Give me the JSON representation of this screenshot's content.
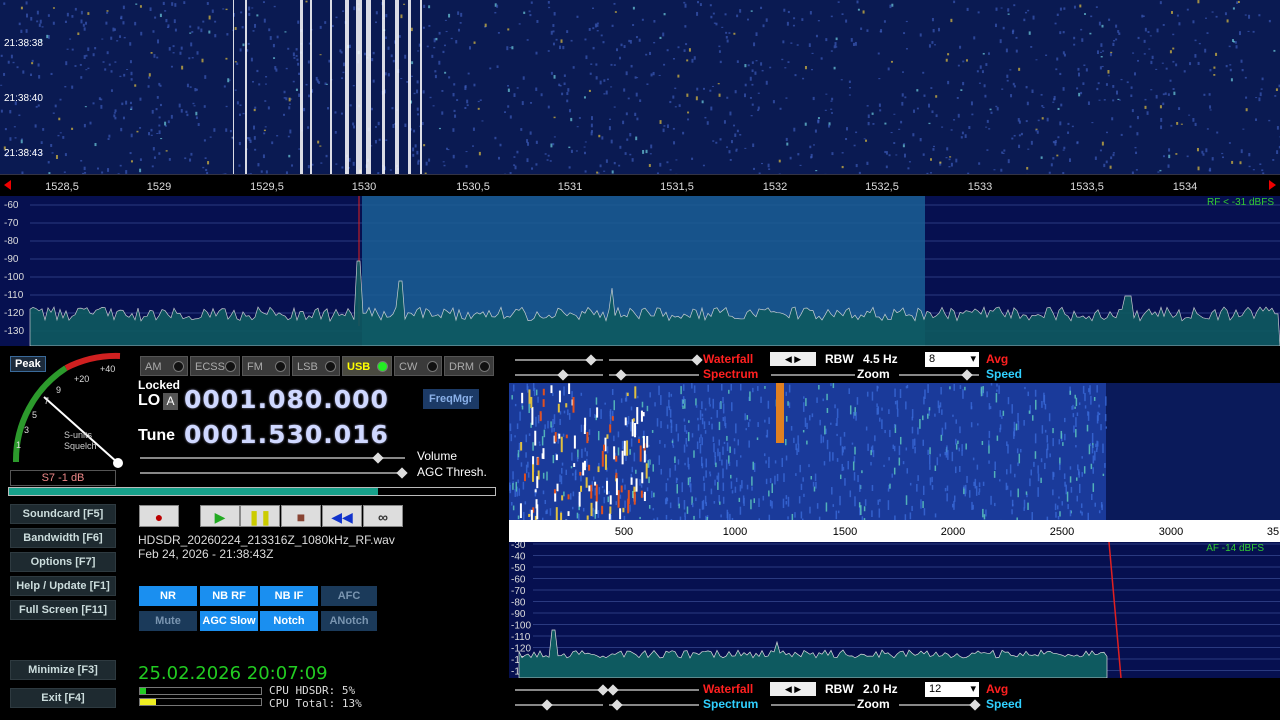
{
  "waterfall_top": {
    "times": [
      "21:38:38",
      "21:38:40",
      "21:38:43"
    ]
  },
  "freq_axis": {
    "ticks": [
      "1528,5",
      "1529",
      "1529,5",
      "1530",
      "1530,5",
      "1531",
      "1531,5",
      "1532",
      "1532,5",
      "1533",
      "1533,5",
      "1534"
    ]
  },
  "rf_spectrum": {
    "db_labels": [
      "-60",
      "-70",
      "-80",
      "-90",
      "-100",
      "-110",
      "-120",
      "-130"
    ],
    "level_text": "RF < -31 dBFS"
  },
  "smeter": {
    "peak": "Peak",
    "scale": [
      "1",
      "3",
      "5",
      "7",
      "9",
      "+20",
      "+40"
    ],
    "label1": "S-units",
    "label2": "Squelch",
    "reading": "S7 -1 dB"
  },
  "modes": [
    {
      "label": "AM",
      "active": false
    },
    {
      "label": "ECSS",
      "active": false
    },
    {
      "label": "FM",
      "active": false
    },
    {
      "label": "LSB",
      "active": false
    },
    {
      "label": "USB",
      "active": true
    },
    {
      "label": "CW",
      "active": false
    },
    {
      "label": "DRM",
      "active": false
    }
  ],
  "lo": {
    "locked": "Locked",
    "lo_label": "LO",
    "a_label": "A",
    "value": "0001.080.000"
  },
  "tune": {
    "label": "Tune",
    "value": "0001.530.016"
  },
  "freqmgr": "FreqMgr",
  "sliders": {
    "volume": "Volume",
    "agc": "AGC Thresh."
  },
  "left_buttons": {
    "soundcard": "Soundcard [F5]",
    "bandwidth": "Bandwidth [F6]",
    "options": "Options [F7]",
    "help": "Help / Update [F1]",
    "fullscreen": "Full Screen [F11]",
    "minimize": "Minimize [F3]",
    "exit": "Exit [F4]"
  },
  "file": {
    "name": "HDSDR_20260224_213316Z_1080kHz_RF.wav",
    "date": "Feb 24, 2026 - 21:38:43Z"
  },
  "dsp": {
    "nr": "NR",
    "nbrf": "NB RF",
    "nbif": "NB IF",
    "afc": "AFC",
    "mute": "Mute",
    "agc": "AGC Slow",
    "notch": "Notch",
    "anotch": "ANotch"
  },
  "clock": "25.02.2026 20:07:09",
  "cpu": {
    "hdsdr": "CPU HDSDR: 5%",
    "total": "CPU Total: 13%",
    "hdsdr_pct": 5,
    "total_pct": 13
  },
  "wf_ctrl_top": {
    "waterfall": "Waterfall",
    "spectrum": "Spectrum",
    "rbw_label": "RBW",
    "rbw": "4.5 Hz",
    "avg": "8",
    "avg_label": "Avg",
    "zoom": "Zoom",
    "speed": "Speed"
  },
  "wf_ctrl_bot": {
    "waterfall": "Waterfall",
    "spectrum": "Spectrum",
    "rbw_label": "RBW",
    "rbw": "2.0 Hz",
    "avg": "12",
    "avg_label": "Avg",
    "zoom": "Zoom",
    "speed": "Speed"
  },
  "af_axis": {
    "ticks": [
      "500",
      "1000",
      "1500",
      "2000",
      "2500",
      "3000",
      "35"
    ]
  },
  "af_spectrum": {
    "db_labels": [
      "-30",
      "-40",
      "-50",
      "-60",
      "-70",
      "-80",
      "-90",
      "-100",
      "-110",
      "-120",
      "-130",
      "-140"
    ],
    "level_text": "AF -14 dBFS"
  },
  "colors": {
    "accent": "#1a8ff0",
    "spectrum_bg": "#061050",
    "passband": "#1b5f95",
    "clock": "#22cc22"
  }
}
